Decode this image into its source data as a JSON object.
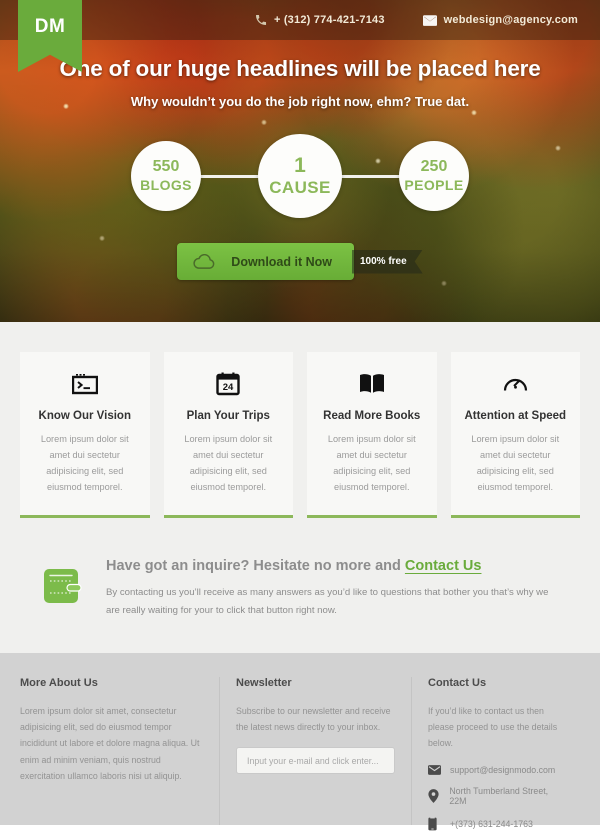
{
  "brand": {
    "logo_text": "DM",
    "accent": "#6aab3c",
    "accent_light": "#8cb85a"
  },
  "topbar": {
    "phone_icon": "phone-icon",
    "phone": "+ (312) 774-421-7143",
    "mail_icon": "envelope-icon",
    "email": "webdesign@agency.com"
  },
  "hero": {
    "headline": "One of our huge headlines will be placed here",
    "subhead": "Why wouldn’t you do the job right now, ehm? True dat.",
    "stats": [
      {
        "number": "550",
        "label": "BLOGS"
      },
      {
        "number": "1",
        "label": "CAUSE"
      },
      {
        "number": "250",
        "label": "PEOPLE"
      }
    ],
    "cta": {
      "icon": "cloud-icon",
      "label": "Download it Now",
      "tag": "100% free"
    }
  },
  "features": [
    {
      "icon": "terminal-icon",
      "title": "Know Our Vision",
      "body": "Lorem ipsum dolor sit amet dui sectetur adipisicing elit, sed eiusmod temporel."
    },
    {
      "icon": "calendar-icon",
      "icon_text": "24",
      "title": "Plan Your Trips",
      "body": "Lorem ipsum dolor sit amet dui sectetur adipisicing elit, sed eiusmod temporel."
    },
    {
      "icon": "book-icon",
      "title": "Read More Books",
      "body": "Lorem ipsum dolor sit amet dui sectetur adipisicing elit, sed eiusmod temporel."
    },
    {
      "icon": "speedometer-icon",
      "title": "Attention at Speed",
      "body": "Lorem ipsum dolor sit amet dui sectetur adipisicing elit, sed eiusmod temporel."
    }
  ],
  "inquire": {
    "icon": "wallet-icon",
    "title_prefix": "Have got an inquire? Hesitate no more and ",
    "link_label": "Contact Us",
    "body": "By contacting us you’ll receive as many answers as you’d like to questions that bother you that’s why we are really waiting for your to click that button right now."
  },
  "footer": {
    "about": {
      "heading": "More About Us",
      "body": "Lorem ipsum dolor sit amet, consectetur adipisicing elit, sed do eiusmod tempor incididunt ut labore et dolore magna aliqua. Ut enim ad minim veniam, quis nostrud exercitation ullamco laboris nisi ut aliquip."
    },
    "newsletter": {
      "heading": "Newsletter",
      "body": "Subscribe to our newsletter and receive the latest news directly to your inbox.",
      "input_value": "",
      "input_placeholder": "Input your e-mail and click enter..."
    },
    "contact": {
      "heading": "Contact Us",
      "body": "If you’d like to contact us then please proceed to use the details below.",
      "items": [
        {
          "icon": "envelope-icon",
          "text": "support@designmodo.com"
        },
        {
          "icon": "location-pin-icon",
          "text": "North Tumberland Street, 22M"
        },
        {
          "icon": "phone-icon",
          "text": "+(373) 631-244-1763"
        }
      ]
    }
  }
}
